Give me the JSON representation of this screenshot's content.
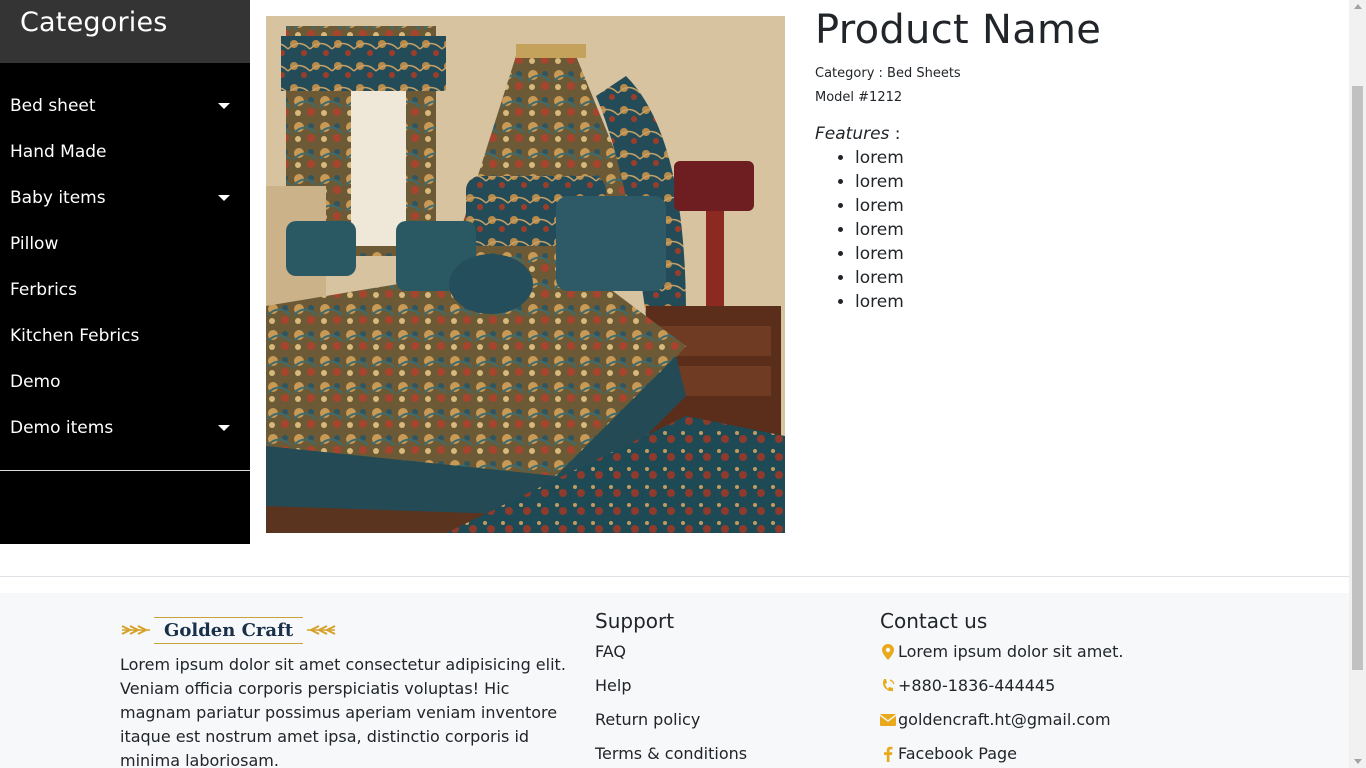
{
  "sidebar": {
    "title": "Categories",
    "items": [
      {
        "label": "Bed sheet",
        "has_dropdown": true
      },
      {
        "label": "Hand Made",
        "has_dropdown": false
      },
      {
        "label": "Baby items",
        "has_dropdown": true
      },
      {
        "label": "Pillow",
        "has_dropdown": false
      },
      {
        "label": "Ferbrics",
        "has_dropdown": false
      },
      {
        "label": "Kitchen Febrics",
        "has_dropdown": false
      },
      {
        "label": "Demo",
        "has_dropdown": false
      },
      {
        "label": "Demo items",
        "has_dropdown": true
      }
    ]
  },
  "product": {
    "name": "Product Name",
    "category": "Category : Bed Sheets",
    "model": "Model #1212",
    "features_label": "Features",
    "features_suffix": " :",
    "features": [
      "lorem",
      "lorem",
      "lorem",
      "lorem",
      "lorem",
      "lorem",
      "lorem"
    ]
  },
  "footer": {
    "logo_text": "Golden Craft",
    "about": "Lorem ipsum dolor sit amet consectetur adipisicing elit. Veniam officia corporis perspiciatis voluptas! Hic magnam pariatur possimus aperiam veniam inventore itaque est nostrum amet ipsa, distinctio corporis id minima laboriosam.",
    "support": {
      "title": "Support",
      "links": [
        "FAQ",
        "Help",
        "Return policy",
        "Terms & conditions"
      ]
    },
    "contact": {
      "title": "Contact us",
      "address": "Lorem ipsum dolor sit amet.",
      "phone": "+880-1836-444445",
      "email": "goldencraft.ht@gmail.com",
      "facebook": "Facebook Page"
    }
  },
  "icons": {
    "location": "map-marker-icon",
    "phone": "phone-icon",
    "email": "envelope-icon",
    "facebook": "facebook-icon"
  },
  "colors": {
    "sidebar_bg": "#000000",
    "sidebar_header_bg": "#343434",
    "accent": "#e9a91c",
    "footer_bg": "#f7f8f9"
  }
}
